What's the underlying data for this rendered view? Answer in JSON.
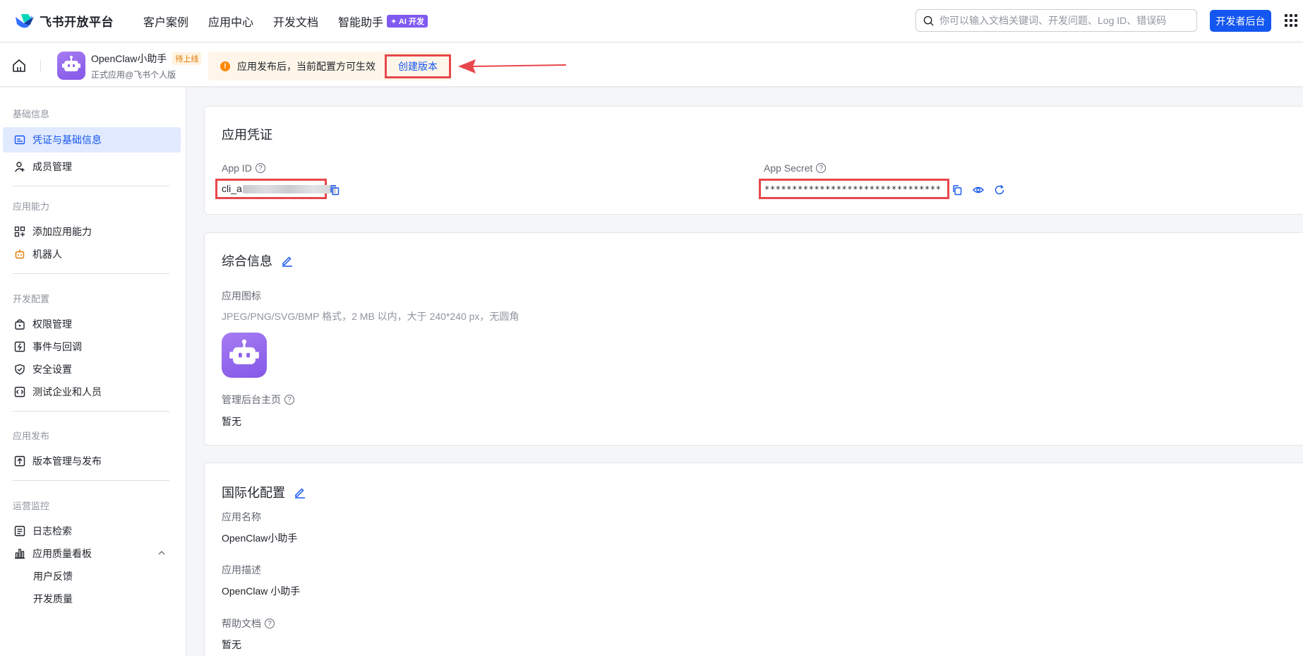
{
  "topnav": {
    "brand": "飞书开放平台",
    "links": [
      "客户案例",
      "应用中心",
      "开发文档",
      "智能助手"
    ],
    "ai_badge": "✦ AI 开发",
    "search_placeholder": "你可以输入文档关键词、开发问题、Log ID、错误码",
    "dev_console": "开发者后台"
  },
  "appbar": {
    "app_name": "OpenClaw小助手",
    "status_tag": "待上线",
    "app_sub": "正式应用@飞书个人版",
    "notice": "应用发布后，当前配置方可生效",
    "create_version": "创建版本"
  },
  "sidebar": {
    "groups": [
      "基础信息",
      "应用能力",
      "开发配置",
      "应用发布",
      "运营监控"
    ],
    "items": [
      "凭证与基础信息",
      "成员管理",
      "添加应用能力",
      "机器人",
      "权限管理",
      "事件与回调",
      "安全设置",
      "测试企业和人员",
      "版本管理与发布",
      "日志检索",
      "应用质量看板",
      "用户反馈",
      "开发质量"
    ]
  },
  "credentials": {
    "title": "应用凭证",
    "app_id_label": "App ID",
    "app_id_value": "cli_a",
    "app_secret_label": "App Secret",
    "app_secret_value": "********************************"
  },
  "general": {
    "title": "综合信息",
    "icon_label": "应用图标",
    "icon_hint": "JPEG/PNG/SVG/BMP 格式，2 MB 以内，大于 240*240 px，无圆角",
    "admin_label": "管理后台主页",
    "admin_value": "暂无"
  },
  "i18n": {
    "title": "国际化配置",
    "name_label": "应用名称",
    "name_value": "OpenClaw小助手",
    "desc_label": "应用描述",
    "desc_value": "OpenClaw 小助手",
    "help_label": "帮助文档",
    "help_value": "暂无"
  },
  "colors": {
    "primary": "#1456f0",
    "highlight": "#e8474b",
    "warning": "#ff8800",
    "app_purple": "#8f63ec"
  }
}
